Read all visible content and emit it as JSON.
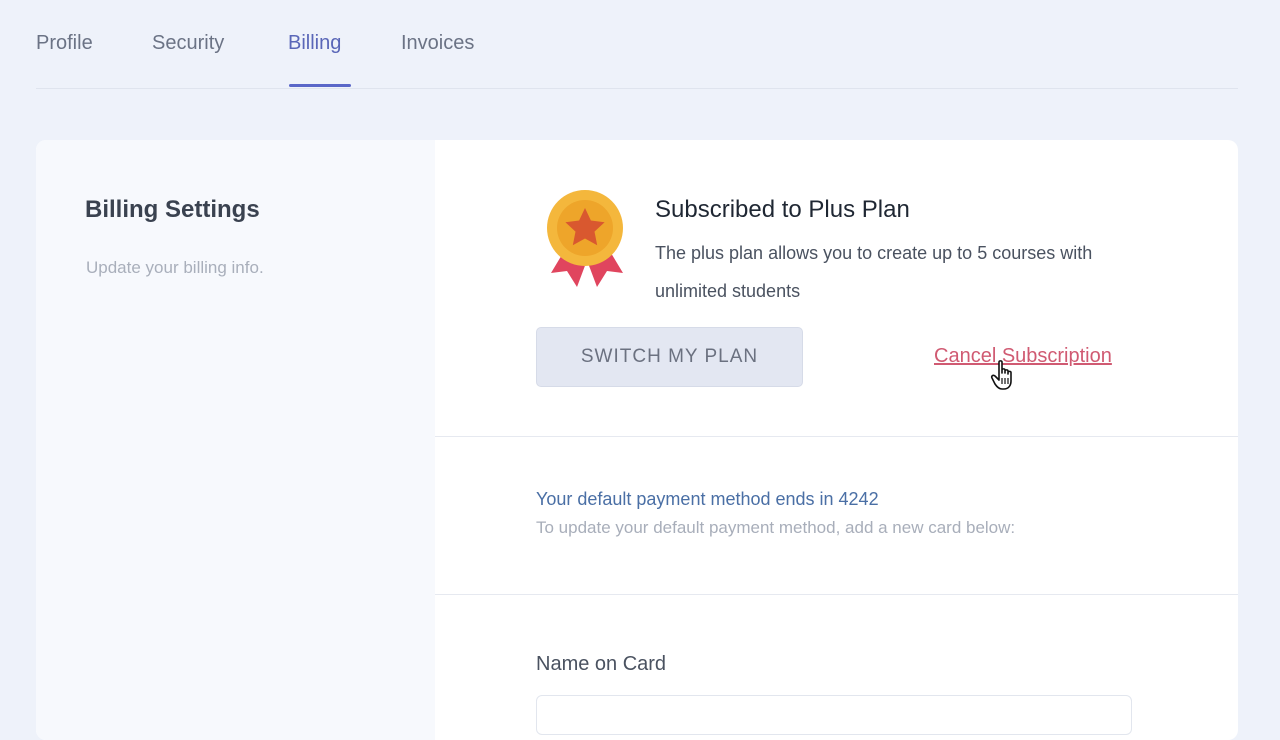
{
  "tabs": [
    {
      "label": "Profile",
      "active": false
    },
    {
      "label": "Security",
      "active": false
    },
    {
      "label": "Billing",
      "active": true
    },
    {
      "label": "Invoices",
      "active": false
    }
  ],
  "settings": {
    "title": "Billing Settings",
    "subtitle": "Update your billing info."
  },
  "plan": {
    "icon": "medal-icon",
    "title": "Subscribed to Plus Plan",
    "description": "The plus plan allows you to create up to 5 courses with unlimited students",
    "switch_label": "SWITCH MY PLAN",
    "cancel_label": "Cancel Subscription"
  },
  "payment": {
    "default_method": "Your default payment method ends in 4242",
    "hint": "To update your default payment method, add a new card below:"
  },
  "card_form": {
    "name_label": "Name on Card",
    "name_value": ""
  },
  "colors": {
    "background": "#eef2fa",
    "accent": "#5a67c8",
    "danger": "#d05a72",
    "medal_gold": "#f4b73c",
    "ribbon_red": "#e0455e"
  }
}
